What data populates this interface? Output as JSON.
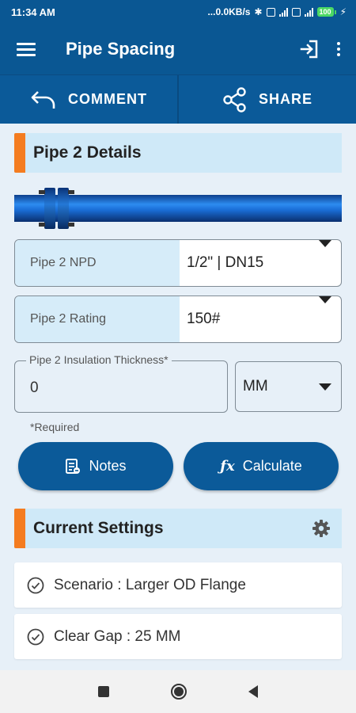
{
  "status_bar": {
    "time": "11:34 AM",
    "network_speed": "...0.0KB/s",
    "battery": "100"
  },
  "app_bar": {
    "title": "Pipe Spacing"
  },
  "actions": {
    "comment_label": "COMMENT",
    "share_label": "SHARE"
  },
  "pipe_details": {
    "title": "Pipe 2 Details",
    "npd": {
      "label": "Pipe 2 NPD",
      "value": "1/2\" | DN15"
    },
    "rating": {
      "label": "Pipe 2 Rating",
      "value": "150#"
    },
    "insulation": {
      "label": "Pipe 2 Insulation Thickness*",
      "value": "0"
    },
    "unit": {
      "value": "MM"
    },
    "required_note": "*Required"
  },
  "buttons": {
    "notes_label": "Notes",
    "calculate_label": "Calculate"
  },
  "current_settings": {
    "title": "Current Settings",
    "items": [
      {
        "text": "Scenario : Larger OD Flange"
      },
      {
        "text": "Clear Gap : 25 MM"
      }
    ]
  },
  "colors": {
    "primary": "#0a5793",
    "accent": "#f47c20",
    "section_bg": "#cfe9f8",
    "page_bg": "#e7f0f8"
  },
  "icons": [
    "menu-icon",
    "login-icon",
    "more-vert-icon",
    "undo-arrow-icon",
    "share-icon",
    "gear-icon",
    "notes-icon",
    "function-fx-icon",
    "check-circle-icon"
  ]
}
